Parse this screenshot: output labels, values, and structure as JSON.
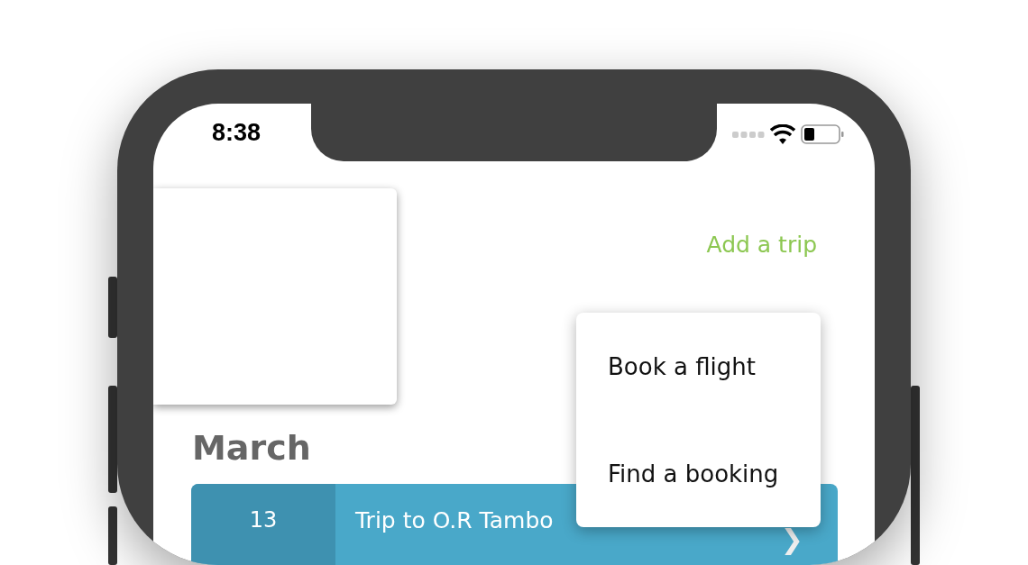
{
  "status_bar": {
    "time": "8:38"
  },
  "header": {
    "add_trip_link": "Add a trip"
  },
  "menu": {
    "items": [
      {
        "label": "Book a flight"
      },
      {
        "label": "Find a booking"
      }
    ]
  },
  "sections": [
    {
      "month": "March",
      "trips": [
        {
          "day": "13",
          "title": "Trip to O.R Tambo",
          "chevron": "❯"
        }
      ]
    }
  ]
}
